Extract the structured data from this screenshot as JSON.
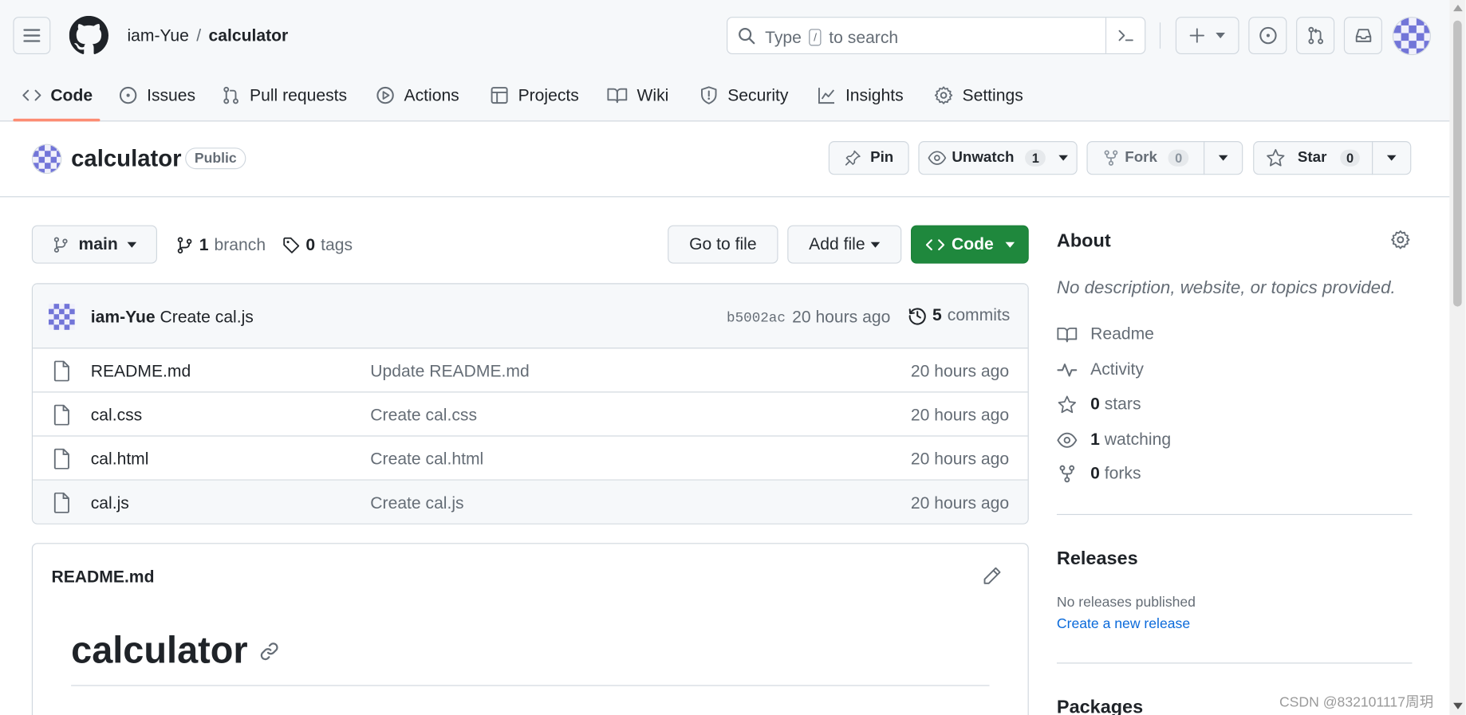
{
  "header": {
    "owner": "iam-Yue",
    "separator": "/",
    "repo": "calculator",
    "search_prefix": "Type",
    "search_key": "/",
    "search_suffix": "to search"
  },
  "tabs": [
    {
      "label": "Code",
      "icon": "code-icon"
    },
    {
      "label": "Issues",
      "icon": "issue-icon"
    },
    {
      "label": "Pull requests",
      "icon": "pull-request-icon"
    },
    {
      "label": "Actions",
      "icon": "play-icon"
    },
    {
      "label": "Projects",
      "icon": "table-icon"
    },
    {
      "label": "Wiki",
      "icon": "book-icon"
    },
    {
      "label": "Security",
      "icon": "shield-icon"
    },
    {
      "label": "Insights",
      "icon": "graph-icon"
    },
    {
      "label": "Settings",
      "icon": "gear-icon"
    }
  ],
  "repo_title": {
    "name": "calculator",
    "visibility": "Public",
    "pin_label": "Pin",
    "unwatch_label": "Unwatch",
    "watch_count": "1",
    "fork_label": "Fork",
    "fork_count": "0",
    "star_label": "Star",
    "star_count": "0"
  },
  "toolbar": {
    "branch": "main",
    "branch_count": "1",
    "branch_label": "branch",
    "tag_count": "0",
    "tag_label": "tags",
    "go_to_file": "Go to file",
    "add_file": "Add file",
    "code": "Code"
  },
  "commit": {
    "author": "iam-Yue",
    "message": "Create cal.js",
    "hash": "b5002ac",
    "time": "20 hours ago",
    "count": "5",
    "count_label": "commits"
  },
  "files": [
    {
      "name": "README.md",
      "message": "Update README.md",
      "time": "20 hours ago"
    },
    {
      "name": "cal.css",
      "message": "Create cal.css",
      "time": "20 hours ago"
    },
    {
      "name": "cal.html",
      "message": "Create cal.html",
      "time": "20 hours ago"
    },
    {
      "name": "cal.js",
      "message": "Create cal.js",
      "time": "20 hours ago"
    }
  ],
  "readme": {
    "filename": "README.md",
    "heading": "calculator"
  },
  "about": {
    "title": "About",
    "description": "No description, website, or topics provided.",
    "readme": "Readme",
    "activity": "Activity",
    "stars_count": "0",
    "stars_label": "stars",
    "watching_count": "1",
    "watching_label": "watching",
    "forks_count": "0",
    "forks_label": "forks"
  },
  "releases": {
    "title": "Releases",
    "none": "No releases published",
    "create": "Create a new release"
  },
  "packages": {
    "title": "Packages"
  },
  "watermark": "CSDN @832101117周玥",
  "colors": {
    "accent_green": "#1f883d",
    "link_blue": "#0969da",
    "tab_underline": "#fd8c73"
  }
}
